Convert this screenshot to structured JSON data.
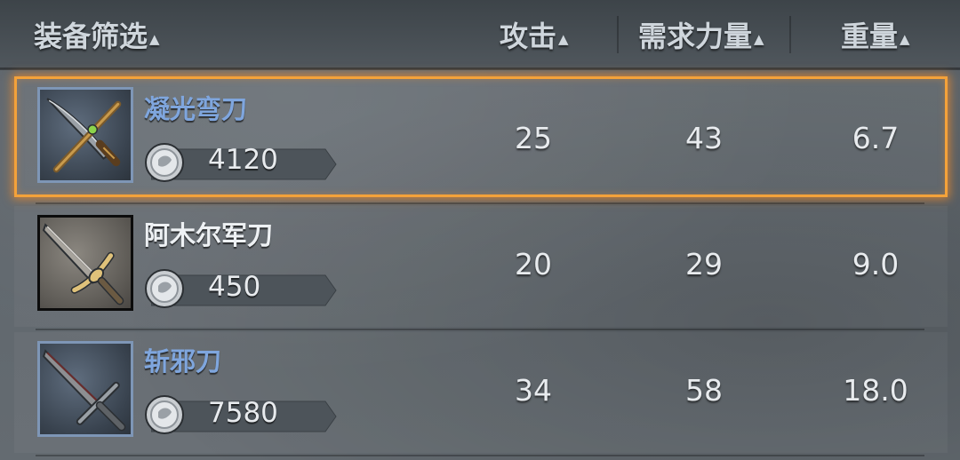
{
  "header": {
    "filter_label": "装备筛选",
    "col_attack": "攻击",
    "col_strength": "需求力量",
    "col_weight": "重量",
    "sort_glyph": "▲"
  },
  "items": [
    {
      "name": "凝光弯刀",
      "price": "4120",
      "attack": "25",
      "strength": "43",
      "weight": "6.7",
      "name_color": "blue",
      "selected": true
    },
    {
      "name": "阿木尔军刀",
      "price": "450",
      "attack": "20",
      "strength": "29",
      "weight": "9.0",
      "name_color": "white",
      "selected": false
    },
    {
      "name": "斩邪刀",
      "price": "7580",
      "attack": "34",
      "strength": "58",
      "weight": "18.0",
      "name_color": "blue",
      "selected": false
    }
  ],
  "icons": {
    "currency": "silver-coin-icon",
    "sort": "sort-up-icon"
  },
  "colors": {
    "selection_border": "#f4a23a",
    "rare_name": "#7fa6de",
    "common_name": "#eef1f4"
  }
}
